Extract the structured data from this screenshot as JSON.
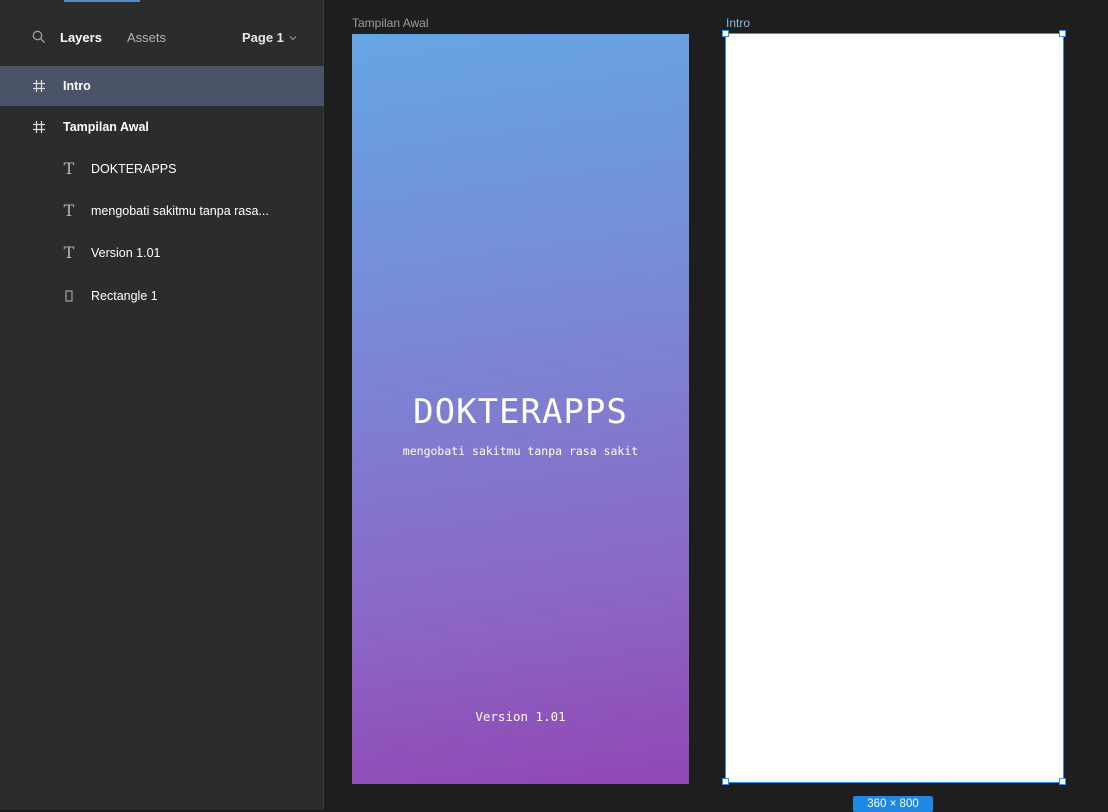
{
  "sidebar": {
    "tabs": {
      "layers": "Layers",
      "assets": "Assets"
    },
    "page_selector": "Page 1",
    "layers": [
      {
        "label": "Intro",
        "type": "frame",
        "icon": "frame-hash-icon",
        "selected": true
      },
      {
        "label": "Tampilan Awal",
        "type": "frame",
        "icon": "frame-hash-icon",
        "selected": false
      },
      {
        "label": "DOKTERAPPS",
        "type": "text",
        "icon": "text-icon",
        "selected": false
      },
      {
        "label": "mengobati sakitmu tanpa rasa...",
        "type": "text",
        "icon": "text-icon",
        "selected": false
      },
      {
        "label": "Version 1.01",
        "type": "text",
        "icon": "text-icon",
        "selected": false
      },
      {
        "label": "Rectangle 1",
        "type": "rectangle",
        "icon": "rectangle-icon",
        "selected": false
      }
    ]
  },
  "canvas": {
    "frame_tampilan": {
      "label": "Tampilan Awal",
      "title": "DOKTERAPPS",
      "subtitle": "mengobati sakitmu tanpa rasa sakit",
      "version": "Version 1.01",
      "gradient_colors": [
        "#66a6e2",
        "#9147b4"
      ]
    },
    "frame_intro": {
      "label": "Intro",
      "size_badge": "360 × 800"
    }
  },
  "colors": {
    "selection": "#3a8ee6",
    "selected_row": "#4a5367",
    "sidebar_bg": "#2c2c2c",
    "canvas_bg": "#1e1e1e"
  }
}
